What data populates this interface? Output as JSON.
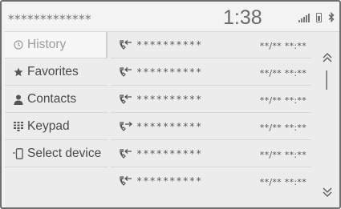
{
  "status": {
    "device_name": "*************",
    "clock": "1:38",
    "icons": [
      "signal-icon",
      "battery-icon",
      "bluetooth-icon"
    ]
  },
  "sidebar": {
    "items": [
      {
        "label": "History",
        "icon": "history-icon",
        "active": true
      },
      {
        "label": "Favorites",
        "icon": "star-icon",
        "active": false
      },
      {
        "label": "Contacts",
        "icon": "contact-icon",
        "active": false
      },
      {
        "label": "Keypad",
        "icon": "keypad-icon",
        "active": false
      },
      {
        "label": "Select device",
        "icon": "phone-icon",
        "active": false
      }
    ]
  },
  "calls": [
    {
      "name": "**********",
      "time": "**/** **:**",
      "direction": "incoming"
    },
    {
      "name": "**********",
      "time": "**/** **:**",
      "direction": "incoming"
    },
    {
      "name": "**********",
      "time": "**/** **:**",
      "direction": "incoming"
    },
    {
      "name": "**********",
      "time": "**/** **:**",
      "direction": "outgoing"
    },
    {
      "name": "**********",
      "time": "**/** **:**",
      "direction": "incoming"
    },
    {
      "name": "**********",
      "time": "**/** **:**",
      "direction": "incoming"
    }
  ],
  "scroll": {
    "up_icon": "chevron-up-icon",
    "down_icon": "chevron-down-icon"
  }
}
